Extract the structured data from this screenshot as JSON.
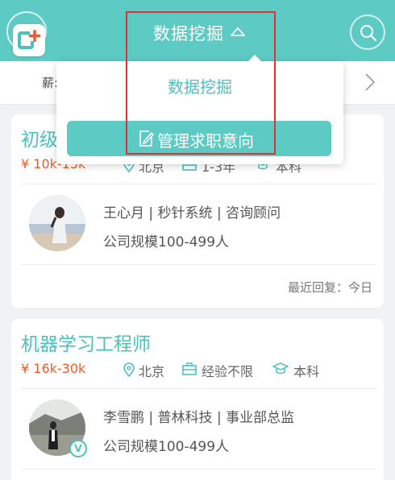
{
  "header": {
    "title": "数据挖掘",
    "add_icon": "add-plus-icon",
    "search_icon": "search-icon",
    "background_color": "#5ecac4"
  },
  "tabbar": {
    "first_tab_partial": "薪:",
    "chevron_icon": "chevron-right-icon"
  },
  "dropdown": {
    "items": [
      "数据挖掘"
    ],
    "manage_button_label": "管理求职意向",
    "manage_icon": "edit-icon"
  },
  "jobs": [
    {
      "title_visible": "初级",
      "salary_partial": "¥ 10k-15k",
      "location_partial": "北京",
      "experience_partial": "1-3年",
      "education_partial": "本科",
      "recruiter_line": "王心月 | 秒针系统 | 咨询顾问",
      "company_size": "公司规模100-499人",
      "reply_text": "最近回复：今日"
    },
    {
      "title": "机器学习工程师",
      "salary": "¥ 16k-30k",
      "location": "北京",
      "experience": "经验不限",
      "education": "本科",
      "recruiter_line": "李雪鹏 | 普林科技 | 事业部总监",
      "company_size": "公司规模100-499人",
      "verified_badge": "V"
    }
  ],
  "colors": {
    "accent": "#4cc1bb",
    "salary": "#f25a2a",
    "highlight": "#d93434"
  }
}
